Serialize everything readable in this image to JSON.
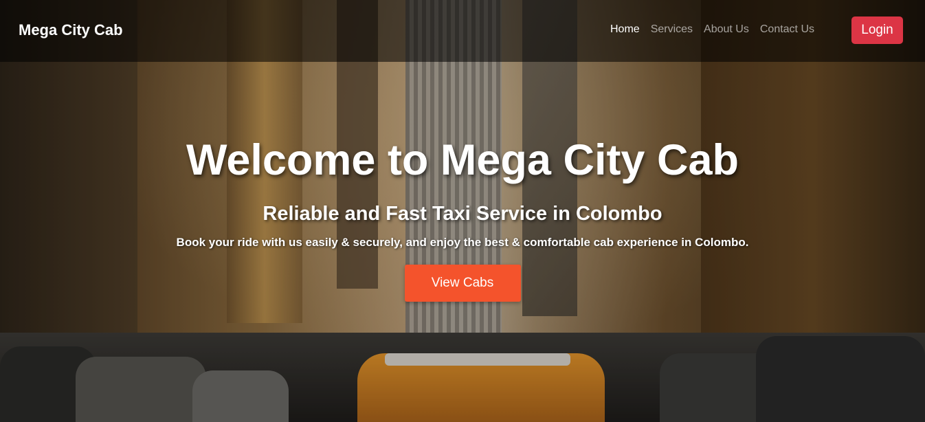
{
  "navbar": {
    "brand": "Mega City Cab",
    "links": [
      {
        "label": "Home",
        "active": true
      },
      {
        "label": "Services",
        "active": false
      },
      {
        "label": "About Us",
        "active": false
      },
      {
        "label": "Contact Us",
        "active": false
      }
    ],
    "login_label": "Login"
  },
  "hero": {
    "title": "Welcome to Mega City Cab",
    "subtitle": "Reliable and Fast Taxi Service in Colombo",
    "text": "Book your ride with us easily & securely, and enjoy the best & comfortable cab experience in Colombo.",
    "cta_label": "View Cabs"
  },
  "colors": {
    "login_button": "#dc3545",
    "cta_button": "#f4532c",
    "navbar_bg": "rgba(0,0,0,0.55)"
  }
}
